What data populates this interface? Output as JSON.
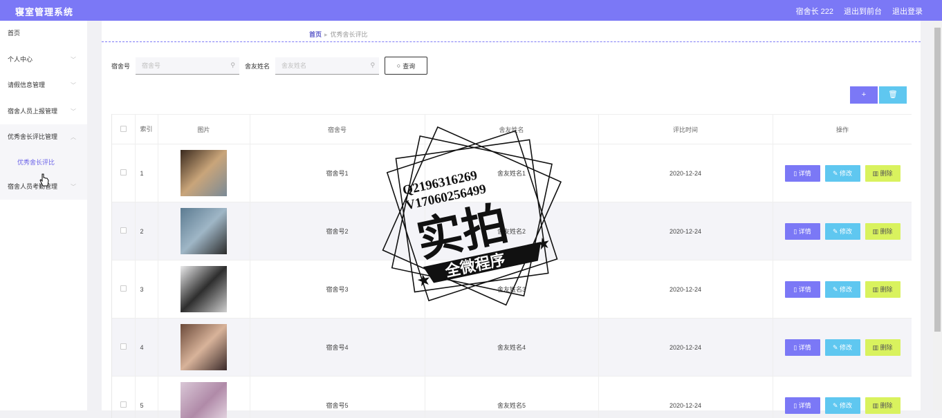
{
  "app": {
    "title": "寝室管理系统"
  },
  "topnav": {
    "user": "宿舍长 222",
    "to_front": "退出到前台",
    "logout": "退出登录"
  },
  "sidebar": {
    "items": [
      {
        "label": "首页"
      },
      {
        "label": "个人中心"
      },
      {
        "label": "请假信息管理"
      },
      {
        "label": "宿舍人员上报管理"
      },
      {
        "label": "优秀舍长评比管理"
      },
      {
        "label": "宿舍人员考勤管理"
      }
    ],
    "active_sub": "优秀舍长评比"
  },
  "breadcrumb": {
    "home": "首页",
    "current": "优秀舍长评比"
  },
  "search": {
    "dorm_label": "宿舍号",
    "dorm_placeholder": "宿舍号",
    "roommate_label": "舍友姓名",
    "roommate_placeholder": "舍友姓名",
    "query_button": "查询"
  },
  "actions": {
    "add": "+",
    "delete_icon": "trash-icon"
  },
  "table": {
    "headers": {
      "index": "索引",
      "photo": "图片",
      "dorm": "宿舍号",
      "roommate": "舍友姓名",
      "time": "评比时间",
      "ops": "操作"
    },
    "rows": [
      {
        "index": "1",
        "dorm": "宿舍号1",
        "roommate": "舍友姓名1",
        "time": "2020-12-24"
      },
      {
        "index": "2",
        "dorm": "宿舍号2",
        "roommate": "舍友姓名2",
        "time": "2020-12-24"
      },
      {
        "index": "3",
        "dorm": "宿舍号3",
        "roommate": "舍友姓名3",
        "time": "2020-12-24"
      },
      {
        "index": "4",
        "dorm": "宿舍号4",
        "roommate": "舍友姓名4",
        "time": "2020-12-24"
      },
      {
        "index": "5",
        "dorm": "宿舍号5",
        "roommate": "舍友姓名5",
        "time": "2020-12-24"
      }
    ],
    "op_labels": {
      "detail": "详情",
      "edit": "修改",
      "delete": "删除"
    }
  },
  "watermark": {
    "line1": "Q2196316269",
    "line2": "V17060256499",
    "big": "实拍",
    "banner": "全微程序"
  },
  "colors": {
    "accent": "#7b78f6",
    "info": "#5fc7f0",
    "warn": "#d9f25e"
  }
}
